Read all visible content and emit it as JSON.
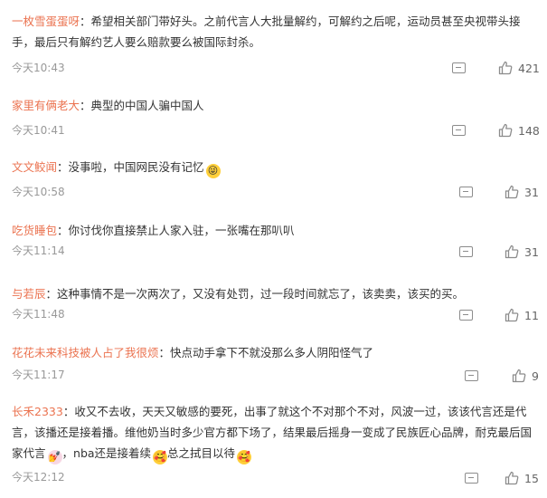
{
  "comments": [
    {
      "user": "一枚雪蛋蛋呀",
      "text": "：希望相关部门带好头。之前代言人大批量解约，可解约之后呢，运动员甚至央视带头接手，最后只有解约艺人要么赔款要么被国际封杀。",
      "emoji": "",
      "time": "今天10:43",
      "likes": "421"
    },
    {
      "user": "家里有俩老大",
      "text": "：典型的中国人骗中国人",
      "emoji": "",
      "time": "今天10:41",
      "likes": "148"
    },
    {
      "user": "文文鲛闻",
      "text": "：没事啦，中国网民没有记忆",
      "emoji": "😜",
      "time": "今天10:58",
      "likes": "31"
    },
    {
      "user": "吃货睡包",
      "text": "：你讨伐你直接禁止人家入驻，一张嘴在那叭叭",
      "emoji": "",
      "time": "今天11:14",
      "likes": "31"
    },
    {
      "user": "与若辰",
      "text": "：这种事情不是一次两次了，又没有处罚，过一段时间就忘了，该卖卖，该买的买。",
      "emoji": "",
      "time": "今天11:48",
      "likes": "11"
    },
    {
      "user": "花花未来科技被人占了我很烦",
      "text": "：快点动手拿下不就没那么多人阴阳怪气了",
      "emoji": "",
      "time": "今天11:17",
      "likes": "9"
    },
    {
      "user": "长禾2333",
      "text": "：收又不去收，天天又敏感的要死，出事了就这个不对那个不对，风波一过，该该代言还是代言，该播还是接着播。维他奶当时多少官方都下场了，结果最后摇身一变成了民族匠心品牌，耐克最后国家代言",
      "text2": "，nba还是接着续",
      "text3": "总之拭目以待",
      "time": "今天12:12",
      "likes": "15"
    }
  ],
  "colors": {
    "username": "#eb7350",
    "meta": "#999999"
  },
  "icons": {
    "reply": "comment-icon",
    "like": "thumb-up-icon"
  }
}
